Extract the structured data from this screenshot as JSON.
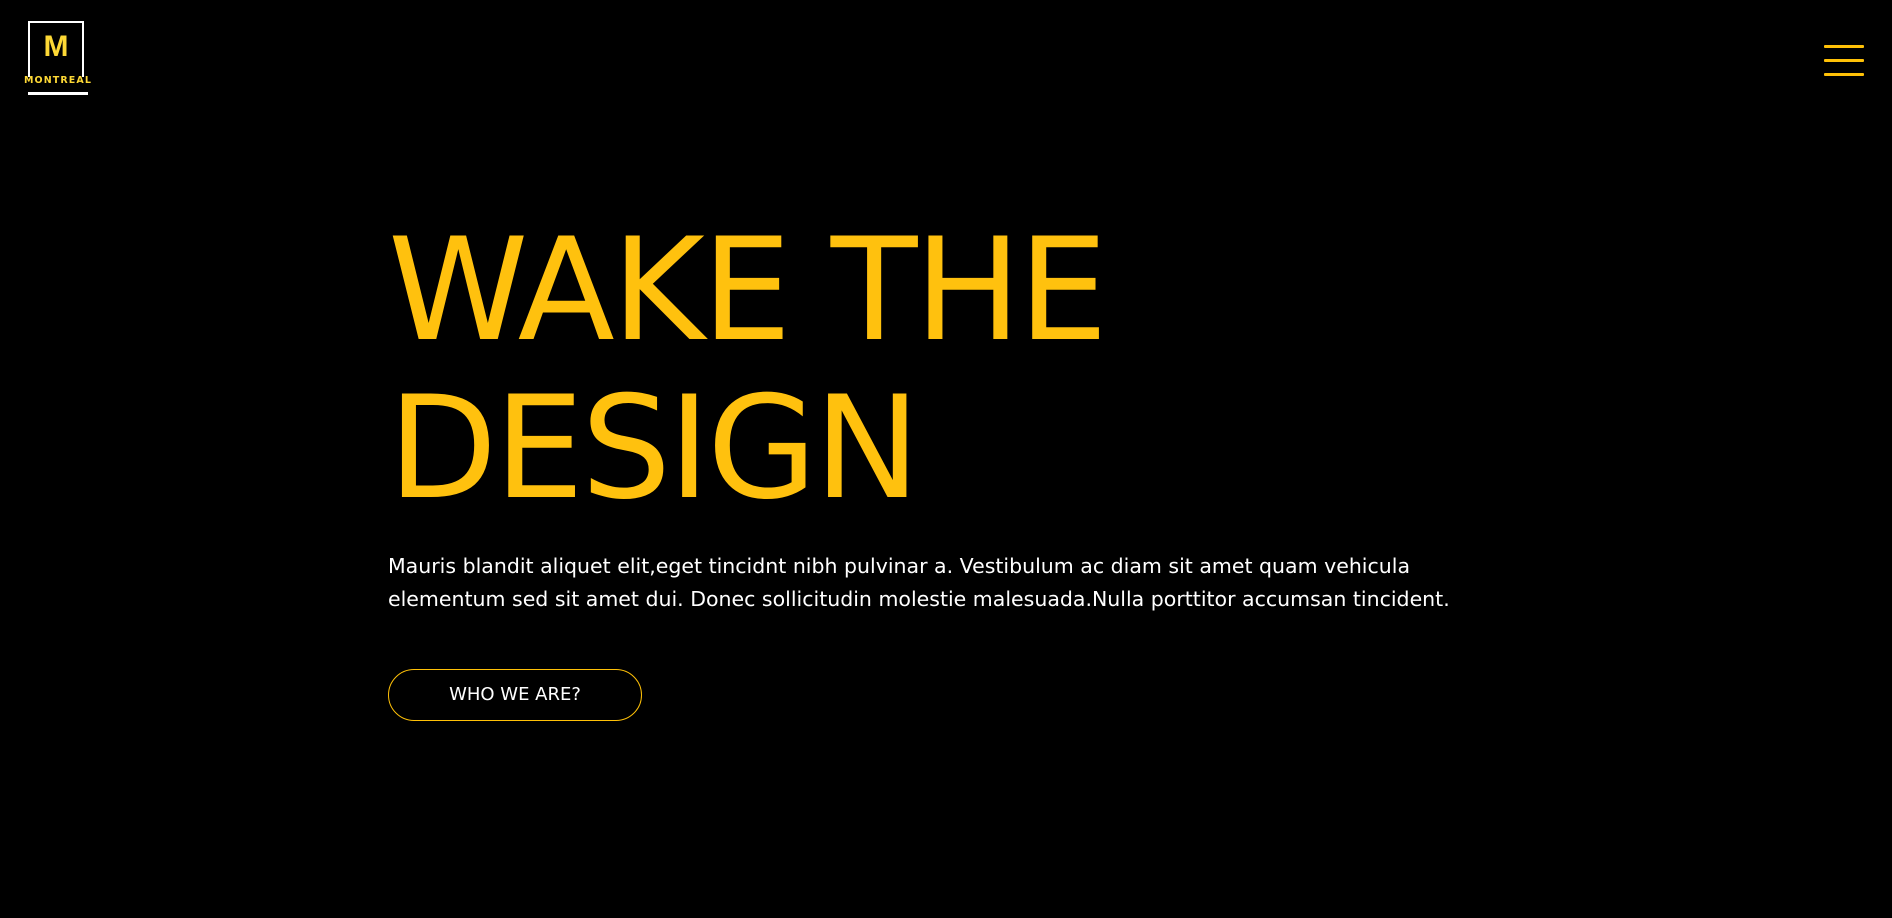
{
  "brand": {
    "logo_letter": "M",
    "logo_word": "MONTREAL"
  },
  "header": {
    "menu_icon": "hamburger-menu-icon"
  },
  "hero": {
    "title_line_1": "WAKE THE",
    "title_line_2": "DESIGN",
    "description": "Mauris blandit aliquet elit,eget tincidnt nibh pulvinar a. Vestibulum ac diam sit amet quam vehicula elementum sed sit amet dui. Donec sollicitudin molestie malesuada.Nulla porttitor accumsan tincident.",
    "cta_label": "WHO WE ARE?"
  },
  "colors": {
    "background": "#000000",
    "accent": "#ffc107",
    "text": "#ffffff"
  }
}
